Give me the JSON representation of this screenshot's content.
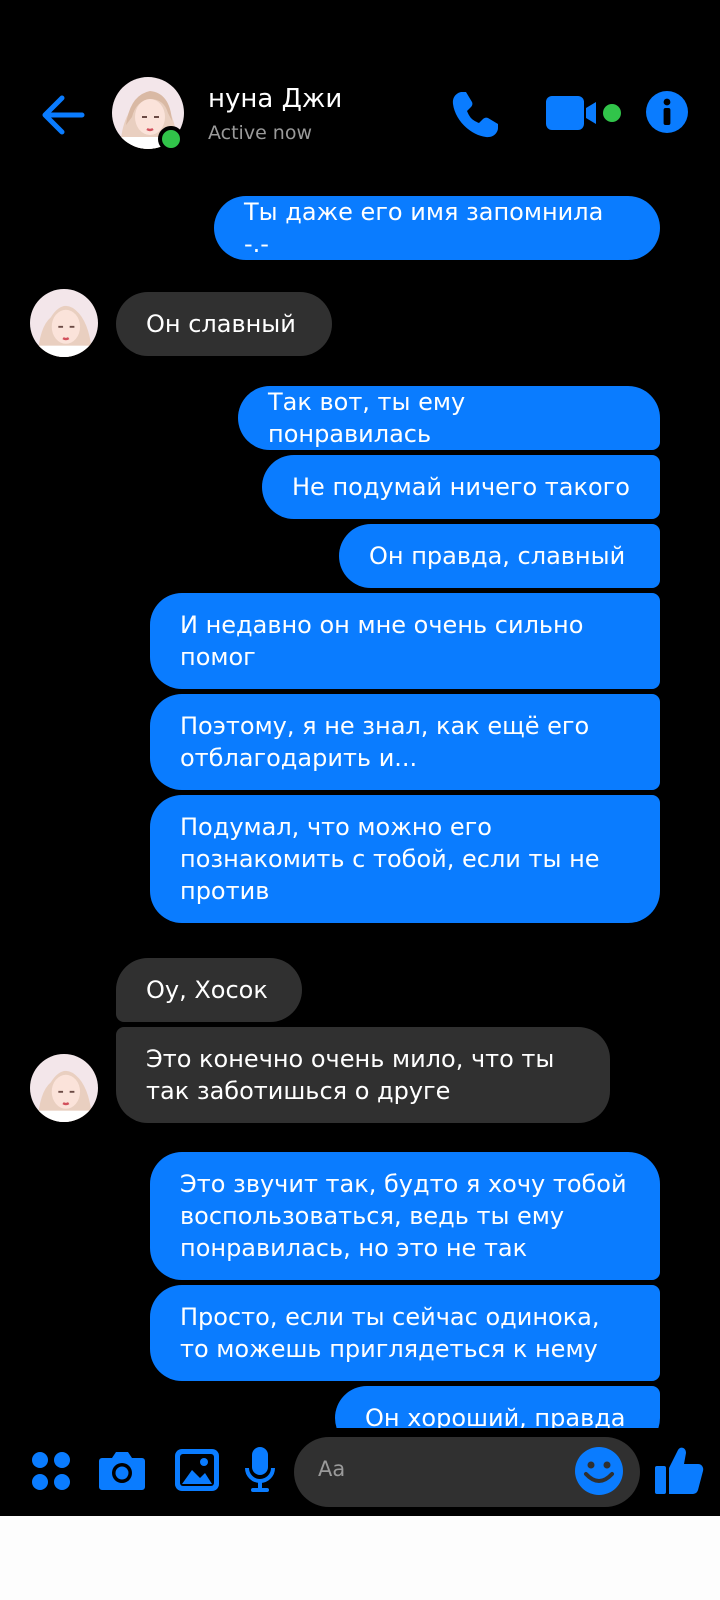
{
  "header": {
    "contact_name": "нуна Джи",
    "status": "Active now",
    "icons": [
      "back-arrow-icon",
      "call-icon",
      "video-call-icon",
      "info-icon"
    ]
  },
  "messages": [
    {
      "dir": "out",
      "text": "Ты даже его имя запомнила -.-"
    },
    {
      "dir": "in",
      "text": "Он славный"
    },
    {
      "dir": "out",
      "text": "Так вот, ты ему понравилась"
    },
    {
      "dir": "out",
      "text": "Не подумай ничего такого"
    },
    {
      "dir": "out",
      "text": "Он правда, славный"
    },
    {
      "dir": "out",
      "text": "И недавно он мне очень сильно помог"
    },
    {
      "dir": "out",
      "text": "Поэтому, я не знал, как ещё его отблагодарить и..."
    },
    {
      "dir": "out",
      "text": "Подумал, что можно его познакомить с тобой, если ты не против"
    },
    {
      "dir": "in",
      "text": "Оу, Хосок"
    },
    {
      "dir": "in",
      "text": "Это конечно очень мило, что ты так заботишься о друге"
    },
    {
      "dir": "out",
      "text": "Это звучит так, будто я хочу тобой воспользоваться, ведь ты ему понравилась, но это не так"
    },
    {
      "dir": "out",
      "text": "Просто, если ты сейчас одинока, то можешь приглядеться к нему"
    },
    {
      "dir": "out",
      "text": "Он хороший, правда"
    }
  ],
  "composer": {
    "placeholder": "Aa",
    "icons": [
      "apps-icon",
      "camera-icon",
      "gallery-icon",
      "microphone-icon",
      "emoji-icon",
      "thumbs-up-icon"
    ]
  },
  "colors": {
    "accent": "#0a7cff",
    "outgoing_bubble": "#0a7cff",
    "incoming_bubble": "#303030",
    "background": "#000000",
    "online": "#31c44a"
  }
}
